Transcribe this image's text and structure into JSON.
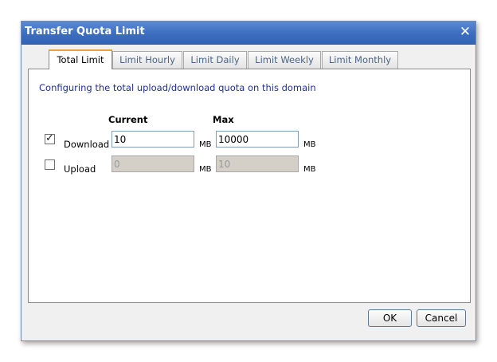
{
  "dialog": {
    "title": "Transfer Quota Limit",
    "close_icon": "close-icon"
  },
  "tabs": [
    {
      "label": "Total Limit",
      "active": true
    },
    {
      "label": "Limit Hourly",
      "active": false
    },
    {
      "label": "Limit Daily",
      "active": false
    },
    {
      "label": "Limit Weekly",
      "active": false
    },
    {
      "label": "Limit Monthly",
      "active": false
    }
  ],
  "panel": {
    "description": "Configuring the total upload/download quota on this domain",
    "col_current": "Current",
    "col_max": "Max",
    "rows": [
      {
        "label": "Download",
        "checked": true,
        "current": "10",
        "current_unit": "MB",
        "max": "10000",
        "max_unit": "MB",
        "enabled": true
      },
      {
        "label": "Upload",
        "checked": false,
        "current": "0",
        "current_unit": "MB",
        "max": "10",
        "max_unit": "MB",
        "enabled": false
      }
    ]
  },
  "buttons": {
    "ok": "OK",
    "cancel": "Cancel"
  },
  "colors": {
    "titlebar": "#3c6dbf",
    "active_tab_accent": "#e8a33c",
    "description_text": "#1f2fa0"
  }
}
